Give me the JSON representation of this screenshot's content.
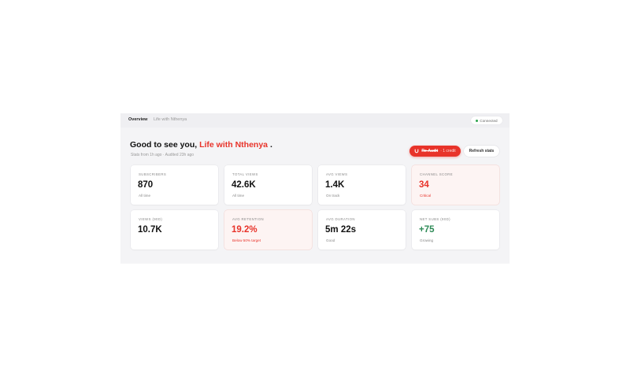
{
  "breadcrumb": {
    "active": "Overview",
    "channel": "Life with Nthenya"
  },
  "status": {
    "label": "Connected",
    "color": "#2ea44f"
  },
  "greeting": {
    "prefix": "Good to see you, ",
    "name": "Life with Nthenya",
    "suffix": " ."
  },
  "meta": "Stats from 1h ago · Audited 23h ago",
  "actions": {
    "reaudit_label": "Re-Audit",
    "reaudit_cost": "· 1 credit",
    "refresh_label": "Refresh stats"
  },
  "colors": {
    "accent": "#e8332a",
    "positive": "#2e8b57",
    "muted": "#888888"
  },
  "cards": [
    {
      "label": "SUBSCRIBERS",
      "value": "870",
      "sub": "All time",
      "state": "normal"
    },
    {
      "label": "TOTAL VIEWS",
      "value": "42.6K",
      "sub": "All time",
      "state": "normal"
    },
    {
      "label": "AVG VIEWS",
      "value": "1.4K",
      "sub": "On track",
      "state": "normal"
    },
    {
      "label": "CHANNEL SCORE",
      "value": "34",
      "sub": "Critical",
      "state": "alert"
    },
    {
      "label": "VIEWS (90D)",
      "value": "10.7K",
      "sub": "",
      "state": "normal"
    },
    {
      "label": "AVG RETENTION",
      "value": "19.2%",
      "sub": "Below 50% target",
      "state": "alert"
    },
    {
      "label": "AVG DURATION",
      "value": "5m 22s",
      "sub": "Good",
      "state": "normal"
    },
    {
      "label": "NET SUBS (90D)",
      "value": "+75",
      "sub": "Growing",
      "state": "good"
    }
  ]
}
